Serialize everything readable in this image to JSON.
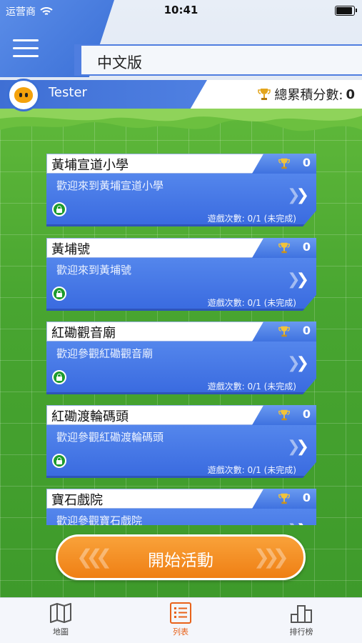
{
  "status_bar": {
    "carrier": "运营商",
    "time": "10:41",
    "battery_level": 0.85
  },
  "header": {
    "title": "中文版",
    "username": "Tester",
    "score_label": "總累積分數:",
    "score_value": "0"
  },
  "locations": [
    {
      "name": "黃埔宣道小學",
      "welcome": "歡迎來到黃埔宣道小學",
      "trophies": "0",
      "plays": "遊戲次數: 0/1 (未完成)"
    },
    {
      "name": "黃埔號",
      "welcome": "歡迎來到黃埔號",
      "trophies": "0",
      "plays": "遊戲次數: 0/1 (未完成)"
    },
    {
      "name": "紅磡觀音廟",
      "welcome": "歡迎參觀紅磡觀音廟",
      "trophies": "0",
      "plays": "遊戲次數: 0/1 (未完成)"
    },
    {
      "name": "紅磡渡輪碼頭",
      "welcome": "歡迎參觀紅磡渡輪碼頭",
      "trophies": "0",
      "plays": "遊戲次數: 0/1 (未完成)"
    },
    {
      "name": "寶石戲院",
      "welcome": "歡迎參觀寶石戲院",
      "trophies": "0",
      "plays": ""
    }
  ],
  "start_button": {
    "label": "開始活動"
  },
  "tabbar": {
    "tabs": [
      {
        "label": "地圖"
      },
      {
        "label": "列表"
      },
      {
        "label": "排行榜"
      }
    ],
    "active": "列表"
  },
  "colors": {
    "accent_blue": "#3f72e0",
    "orange": "#ef7f14",
    "green": "#48a530",
    "active_tab": "#e8621a"
  }
}
